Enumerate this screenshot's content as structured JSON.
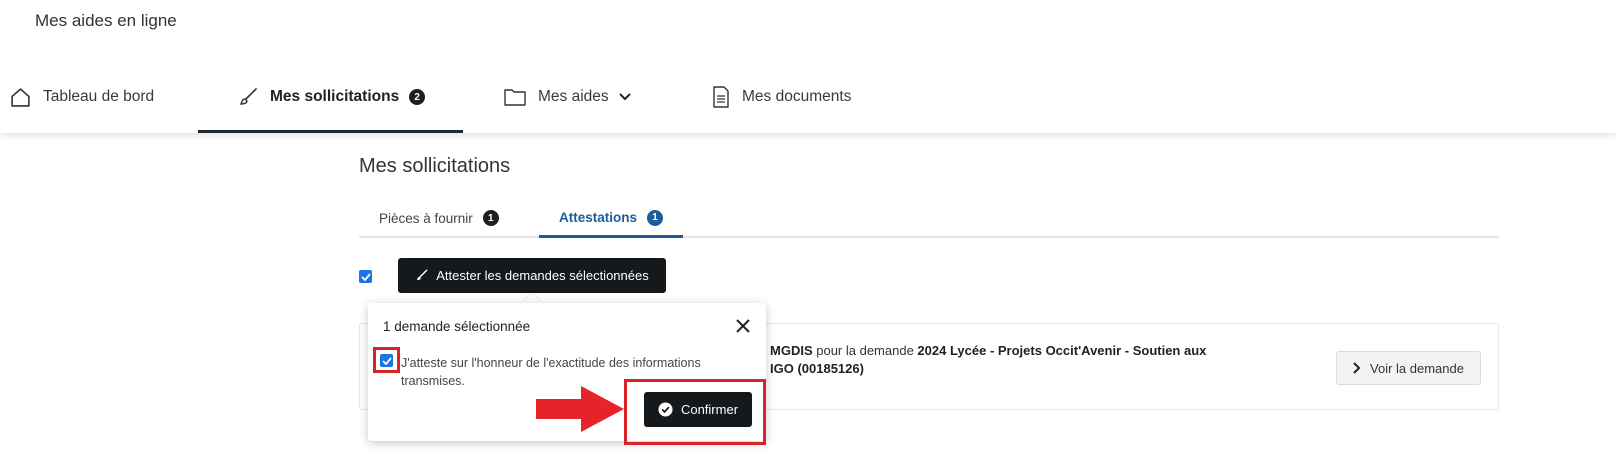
{
  "app": {
    "title": "Mes aides en ligne"
  },
  "nav": {
    "items": [
      {
        "label": "Tableau de bord",
        "icon": "home-icon"
      },
      {
        "label": "Mes sollicitations",
        "icon": "brush-icon",
        "badge": "2",
        "active": true
      },
      {
        "label": "Mes aides",
        "icon": "folder-icon",
        "has_dropdown": true
      },
      {
        "label": "Mes documents",
        "icon": "document-icon"
      }
    ]
  },
  "page": {
    "title": "Mes sollicitations"
  },
  "subtabs": [
    {
      "label": "Pièces à fournir",
      "badge": "1"
    },
    {
      "label": "Attestations",
      "badge": "1",
      "active": true
    }
  ],
  "toolbar": {
    "select_all_checked": true,
    "attest_button": "Attester les demandes sélectionnées"
  },
  "card": {
    "org": "MGDIS",
    "text_middle": " pour la demande ",
    "demand_line1": "2024 Lycée - Projets Occit'Avenir - Soutien aux",
    "demand_line2": "IGO (00185126)",
    "view_button": "Voir la demande"
  },
  "popover": {
    "title": "1 demande sélectionnée",
    "checkbox_checked": true,
    "checkbox_label": "J'atteste sur l'honneur de l'exactitude des informations transmises.",
    "confirm_button": "Confirmer"
  },
  "colors": {
    "accent_blue": "#1c5d99",
    "dark_button": "#15191c",
    "highlight_red": "#d9232a",
    "checkbox_blue": "#1a73e8"
  }
}
